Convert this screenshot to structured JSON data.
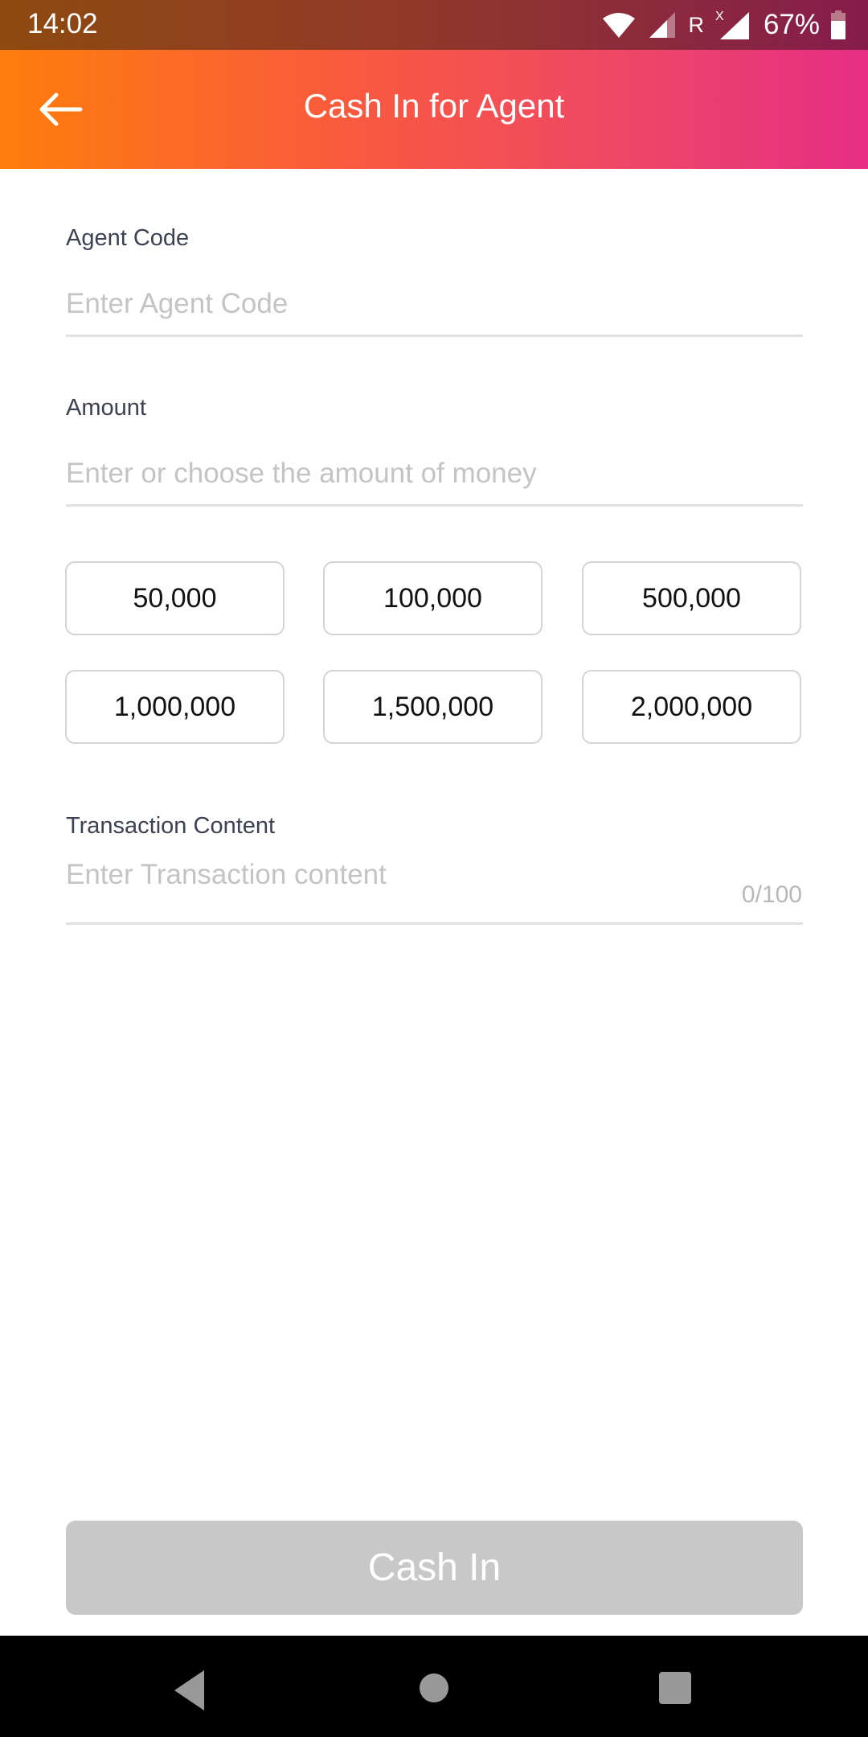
{
  "status_bar": {
    "time": "14:02",
    "roaming": "R",
    "battery": "67%",
    "icons": [
      "wifi-icon",
      "signal-icon",
      "roaming-icon",
      "no-data-signal-icon",
      "battery-icon"
    ]
  },
  "header": {
    "title": "Cash In for Agent",
    "back_icon": "arrow-left-icon"
  },
  "form": {
    "agent_code": {
      "label": "Agent Code",
      "placeholder": "Enter Agent Code",
      "value": ""
    },
    "amount": {
      "label": "Amount",
      "placeholder": "Enter or choose the amount of money",
      "value": "",
      "presets": [
        "50,000",
        "100,000",
        "500,000",
        "1,000,000",
        "1,500,000",
        "2,000,000"
      ]
    },
    "transaction_content": {
      "label": "Transaction Content",
      "placeholder": "Enter Transaction content",
      "value": "",
      "counter": "0/100"
    }
  },
  "submit": {
    "label": "Cash In",
    "enabled": false
  },
  "colors": {
    "header_gradient_start": "#fe7d0c",
    "header_gradient_end": "#e62e85",
    "disabled_button": "#c8c8c8",
    "label_text": "#3d4152",
    "placeholder_text": "#c4c4c4"
  }
}
